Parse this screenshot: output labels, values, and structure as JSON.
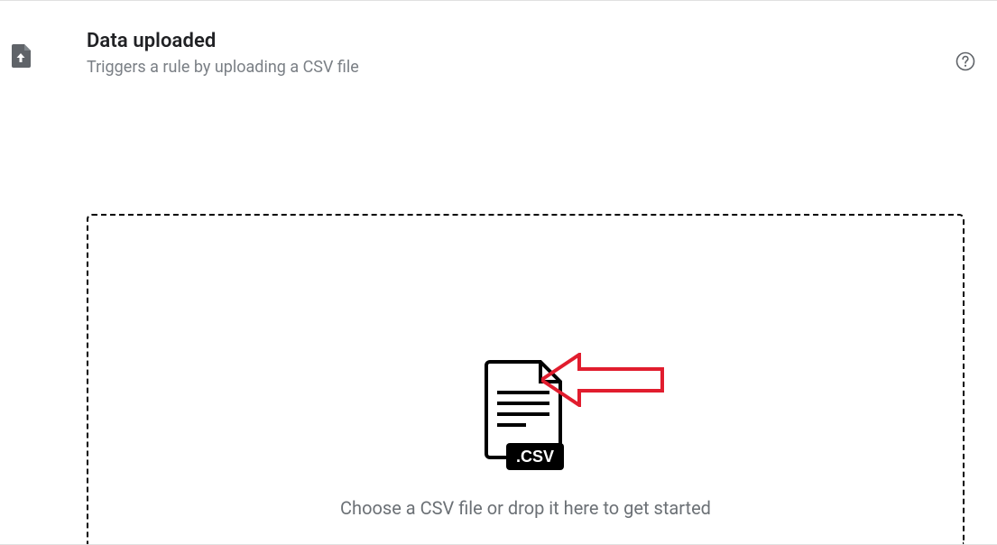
{
  "header": {
    "title": "Data uploaded",
    "subtitle": "Triggers a rule by uploading a CSV file"
  },
  "dropzone": {
    "instruction": "Choose a CSV file or drop it here to get started",
    "file_ext_label": ".CSV"
  },
  "icons": {
    "page": "file-upload-icon",
    "csv": "csv-file-icon",
    "help": "help-icon"
  },
  "colors": {
    "title": "#202124",
    "muted": "#7a7f85",
    "border": "#000000",
    "arrow": "#e11d2e"
  }
}
